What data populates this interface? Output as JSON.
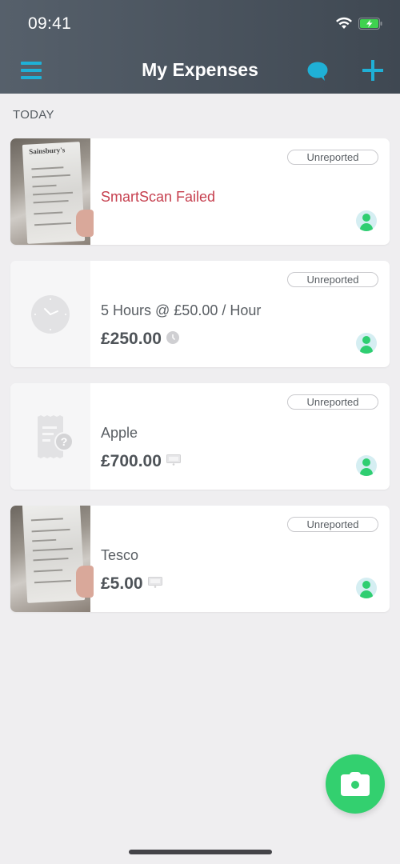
{
  "status_bar": {
    "time": "09:41",
    "wifi_icon": "wifi-icon",
    "battery_icon": "battery-charging-icon"
  },
  "header": {
    "title": "My Expenses",
    "menu_icon": "hamburger-menu-icon",
    "chat_icon": "chat-bubble-icon",
    "add_icon": "plus-icon",
    "accent_color": "#1fb0d6"
  },
  "section": {
    "label": "TODAY"
  },
  "expenses": [
    {
      "thumbnail": "receipt-photo",
      "badge": "Unreported",
      "title": "SmartScan Failed",
      "title_style": "error",
      "amount": "",
      "amount_icon": "",
      "avatar_icon": "user-avatar-icon"
    },
    {
      "thumbnail": "clock-icon",
      "badge": "Unreported",
      "title": "5 Hours @ £50.00 / Hour",
      "title_style": "normal",
      "amount": "£250.00",
      "amount_icon": "time-icon",
      "avatar_icon": "user-avatar-icon"
    },
    {
      "thumbnail": "receipt-missing-icon",
      "badge": "Unreported",
      "title": "Apple",
      "title_style": "normal",
      "amount": "£700.00",
      "amount_icon": "cash-icon",
      "avatar_icon": "user-avatar-icon"
    },
    {
      "thumbnail": "receipt-photo",
      "badge": "Unreported",
      "title": "Tesco",
      "title_style": "normal",
      "amount": "£5.00",
      "amount_icon": "cash-icon",
      "avatar_icon": "user-avatar-icon"
    }
  ],
  "receipt_brand": "Sainsbury's",
  "colors": {
    "error": "#c6404f",
    "success": "#33d06f",
    "header_bg": "#4a535d"
  },
  "fab": {
    "icon": "camera-icon"
  }
}
